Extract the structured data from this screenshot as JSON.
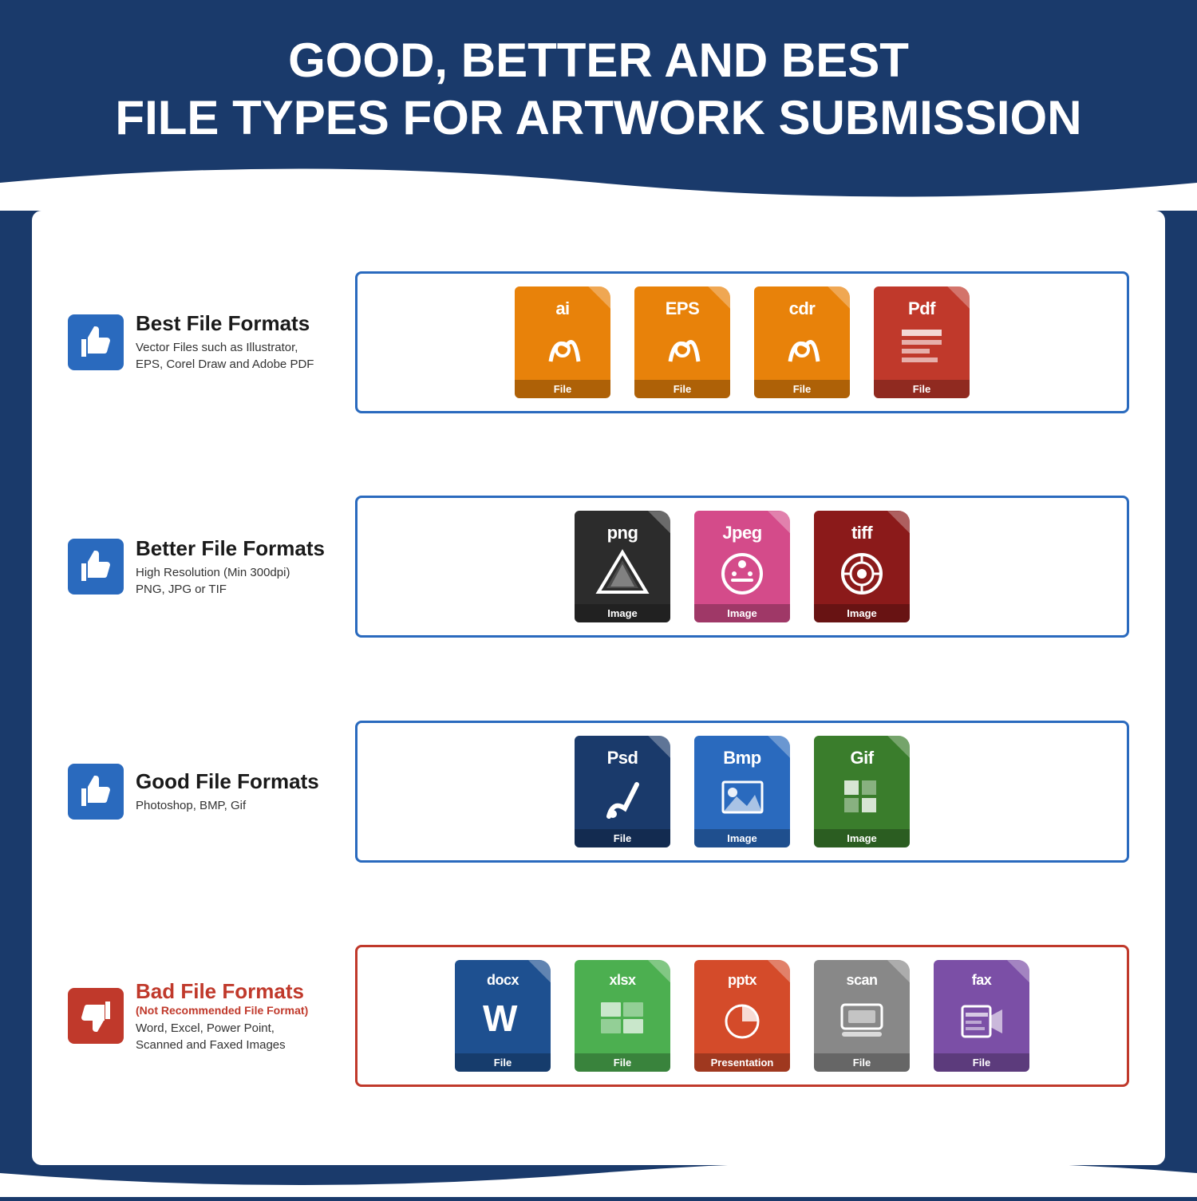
{
  "header": {
    "line1": "GOOD, BETTER AND BEST",
    "line2": "FILE TYPES FOR ARTWORK SUBMISSION"
  },
  "rows": [
    {
      "id": "best",
      "title": "Best File Formats",
      "subtitle": "",
      "description": "Vector Files such as Illustrator,\nEPS, Corel Draw and Adobe PDF",
      "thumbs": "up",
      "borderColor": "#2a6abe",
      "files": [
        {
          "ext": "ai",
          "color": "#e8820a",
          "label": "File",
          "graphic": "pen"
        },
        {
          "ext": "EPS",
          "color": "#e8820a",
          "label": "File",
          "graphic": "pen"
        },
        {
          "ext": "cdr",
          "color": "#e8820a",
          "label": "File",
          "graphic": "pen"
        },
        {
          "ext": "Pdf",
          "color": "#c0392b",
          "label": "File",
          "graphic": "pdf"
        }
      ]
    },
    {
      "id": "better",
      "title": "Better File Formats",
      "subtitle": "",
      "description": "High Resolution (Min 300dpi)\nPNG, JPG or TIF",
      "thumbs": "up",
      "borderColor": "#2a6abe",
      "files": [
        {
          "ext": "png",
          "color": "#2c2c2c",
          "label": "Image",
          "graphic": "star"
        },
        {
          "ext": "Jpeg",
          "color": "#d44b8a",
          "label": "Image",
          "graphic": "camera"
        },
        {
          "ext": "tiff",
          "color": "#8b1a1a",
          "label": "Image",
          "graphic": "gear"
        }
      ]
    },
    {
      "id": "good",
      "title": "Good File Formats",
      "subtitle": "",
      "description": "Photoshop, BMP, Gif",
      "thumbs": "up",
      "borderColor": "#2a6abe",
      "files": [
        {
          "ext": "Psd",
          "color": "#1a3a6b",
          "label": "File",
          "graphic": "brush"
        },
        {
          "ext": "Bmp",
          "color": "#2a6abe",
          "label": "Image",
          "graphic": "mountain"
        },
        {
          "ext": "Gif",
          "color": "#3a7d2c",
          "label": "Image",
          "graphic": "grid"
        }
      ]
    },
    {
      "id": "bad",
      "title": "Bad File Formats",
      "subtitle": "(Not Recommended File Format)",
      "description": "Word, Excel, Power Point,\nScanned and Faxed Images",
      "thumbs": "down",
      "borderColor": "#c0392b",
      "files": [
        {
          "ext": "docx",
          "color": "#1e5090",
          "label": "File",
          "graphic": "word"
        },
        {
          "ext": "xlsx",
          "color": "#4caf50",
          "label": "File",
          "graphic": "excel"
        },
        {
          "ext": "pptx",
          "color": "#d44b2a",
          "label": "Presentation",
          "graphic": "ppt"
        },
        {
          "ext": "scan",
          "color": "#888888",
          "label": "File",
          "graphic": "scan"
        },
        {
          "ext": "fax",
          "color": "#7b4fa6",
          "label": "File",
          "graphic": "fax"
        }
      ]
    }
  ]
}
